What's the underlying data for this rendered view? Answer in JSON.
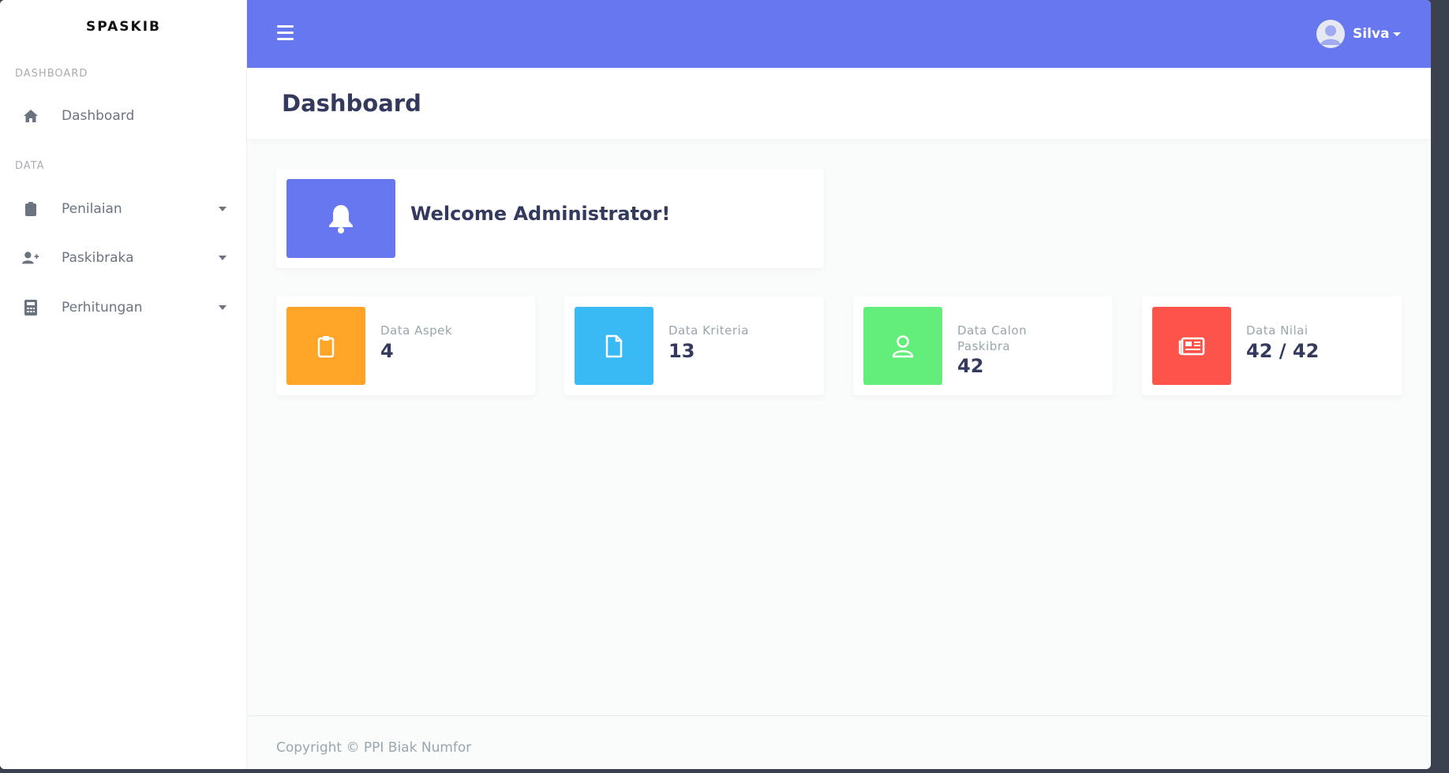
{
  "sidebar": {
    "brand": "SPASKIB",
    "sections": [
      {
        "heading": "DASHBOARD"
      },
      {
        "heading": "DATA"
      }
    ],
    "items": [
      {
        "label": "Dashboard",
        "icon": "home-icon"
      },
      {
        "label": "Penilaian",
        "icon": "clipboard-icon"
      },
      {
        "label": "Paskibraka",
        "icon": "user-plus-icon"
      },
      {
        "label": "Perhitungan",
        "icon": "calculator-icon"
      }
    ]
  },
  "topbar": {
    "user_name": "Silva",
    "icons": [
      "hamburger-menu-icon",
      "avatar-icon"
    ]
  },
  "page": {
    "title": "Dashboard"
  },
  "welcome": {
    "text": "Welcome Administrator!",
    "icon": "bell-icon",
    "color": "#6777ef"
  },
  "stats": [
    {
      "label": "Data Aspek",
      "value": "4",
      "icon": "clipboard-icon",
      "color": "#ffa426"
    },
    {
      "label": "Data Kriteria",
      "value": "13",
      "icon": "file-icon",
      "color": "#3abaf4"
    },
    {
      "label": "Data Calon Paskibra",
      "value": "42",
      "icon": "user-icon",
      "color": "#63ed7a"
    },
    {
      "label": "Data Nilai",
      "value": "42 / 42",
      "icon": "newspaper-icon",
      "color": "#fc544b"
    }
  ],
  "footer": {
    "text": "Copyright © PPI Biak Numfor"
  },
  "colors": {
    "accent": "#6777ef",
    "title": "#34395e"
  }
}
